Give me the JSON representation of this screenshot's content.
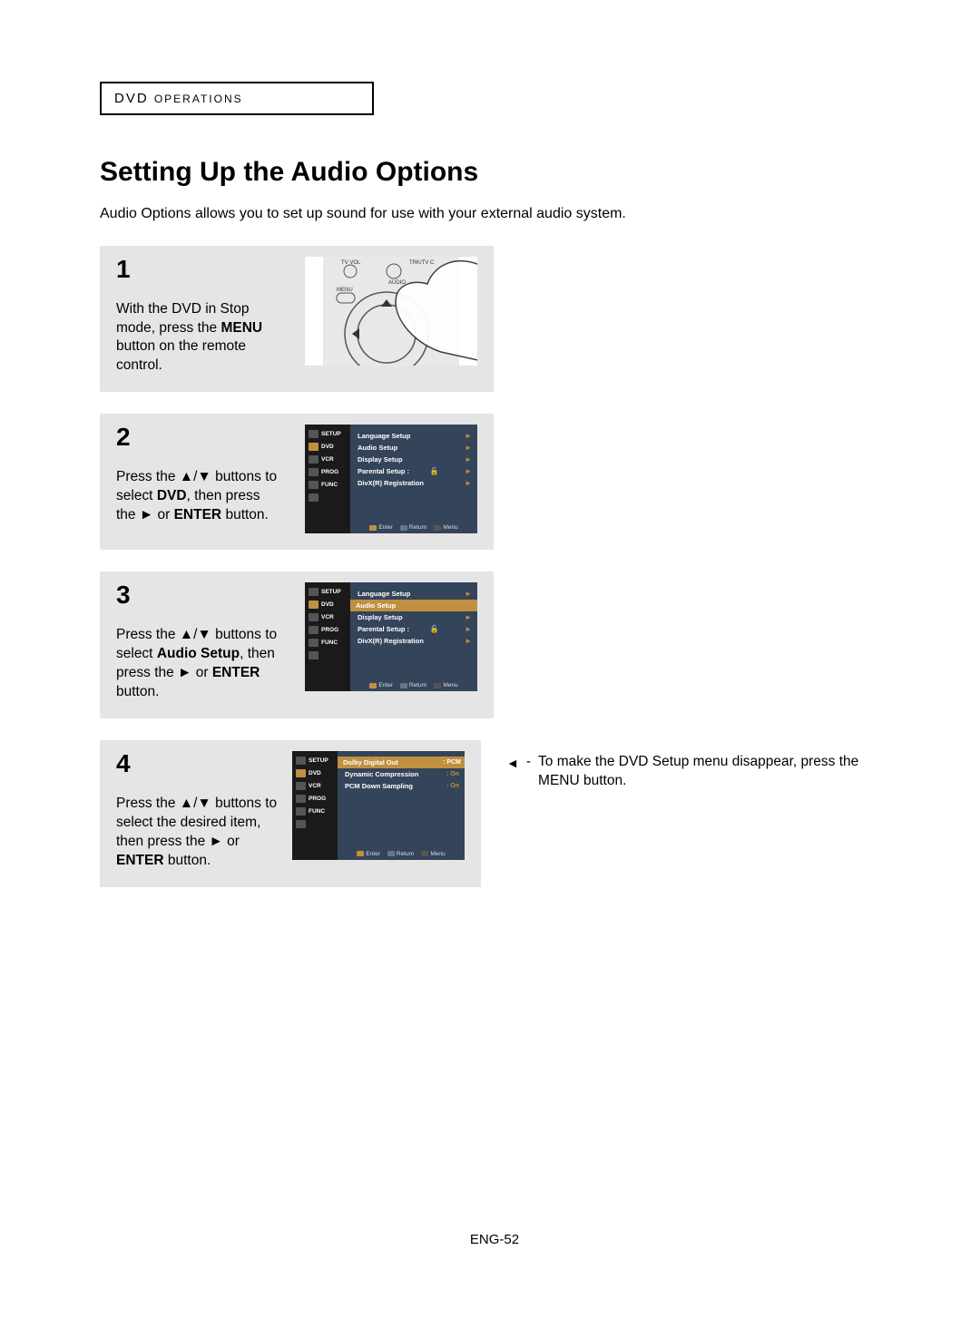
{
  "header": {
    "section_label": "DVD",
    "section_label_small": "OPERATIONS"
  },
  "title": "Setting Up the Audio Options",
  "intro": "Audio Options allows you to set up sound for use with your external audio system.",
  "remote_labels": {
    "tvvol": "TV VOL",
    "trktv": "TRK/TV C",
    "audio": "AUDIO",
    "menu": "MENU"
  },
  "steps": [
    {
      "num": "1",
      "text_parts": [
        "With the DVD in Stop mode, press the ",
        "MENU",
        " button on the remote control."
      ]
    },
    {
      "num": "2",
      "text_parts": [
        "Press the ▲/▼ buttons to select ",
        "DVD",
        ", then press the ►  or ",
        "ENTER",
        " button."
      ]
    },
    {
      "num": "3",
      "text_parts": [
        "Press the ▲/▼ buttons to select ",
        "Audio Setup",
        ", then press the ►  or ",
        "ENTER",
        " button."
      ]
    },
    {
      "num": "4",
      "text_parts": [
        "Press the ▲/▼ buttons to select the desired item, then press the ►  or ",
        "ENTER",
        " button."
      ]
    }
  ],
  "menu_common": {
    "sidebar": [
      "SETUP",
      "DVD",
      "VCR",
      "PROG",
      "FUNC"
    ],
    "footer": {
      "enter": "Enter",
      "return": "Return",
      "menu": "Menu"
    }
  },
  "menu2": {
    "items": [
      {
        "label": "Language Setup",
        "type": "arrow"
      },
      {
        "label": "Audio Setup",
        "type": "arrow"
      },
      {
        "label": "Display Setup",
        "type": "arrow"
      },
      {
        "label": "Parental Setup :",
        "type": "lock-arrow"
      },
      {
        "label": "DivX(R) Registration",
        "type": "arrow"
      }
    ],
    "highlight_index": -1
  },
  "menu3": {
    "items": [
      {
        "label": "Language Setup",
        "type": "arrow"
      },
      {
        "label": "Audio Setup",
        "type": "arrow"
      },
      {
        "label": "Display Setup",
        "type": "arrow"
      },
      {
        "label": "Parental Setup :",
        "type": "lock-arrow"
      },
      {
        "label": "DivX(R) Registration",
        "type": "arrow"
      }
    ],
    "highlight_index": 1
  },
  "menu4": {
    "items": [
      {
        "label": "Dolby Digital Out",
        "value": ": PCM"
      },
      {
        "label": "Dynamic Compression",
        "value": ": On"
      },
      {
        "label": "PCM Down Sampling",
        "value": ": On"
      }
    ],
    "highlight_index": 0
  },
  "note": "To make the DVD Setup menu disappear, press the MENU button.",
  "page_num": "ENG-52"
}
